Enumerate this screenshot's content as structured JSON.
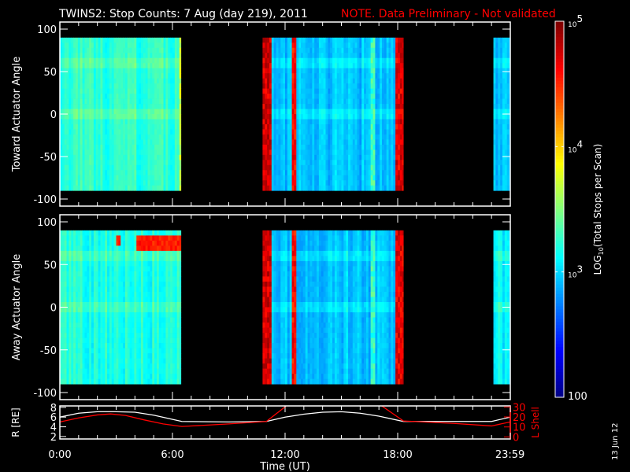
{
  "title": {
    "main": "TWINS2: Stop Counts:  7 Aug (day 219), 2011",
    "note": "NOTE. Data Preliminary - Not validated",
    "note_color": "#ff0000"
  },
  "side_date": "13 Jun 12",
  "chart_data": {
    "type": "heatmap",
    "x_range_hours": [
      0,
      24
    ],
    "xlabel": "Time (UT)",
    "xticks": [
      {
        "h": 0,
        "label": "0:00"
      },
      {
        "h": 6,
        "label": "6:00"
      },
      {
        "h": 12,
        "label": "12:00"
      },
      {
        "h": 18,
        "label": "18:00"
      },
      {
        "h": 23.983,
        "label": "23:59"
      }
    ],
    "colorbar": {
      "label": "LOG10(Total Stops per Scan)",
      "label_main": "LOG",
      "label_sub": "10",
      "label_rest": "(Total Stops per Scan)",
      "range_log": [
        2,
        5
      ],
      "ticks": [
        {
          "log": 5,
          "label": "10",
          "exp": "5"
        },
        {
          "log": 4,
          "label": "10",
          "exp": "4"
        },
        {
          "log": 3,
          "label": "10",
          "exp": "3"
        },
        {
          "log": 2,
          "label": "100",
          "exp": ""
        }
      ]
    },
    "panels": [
      {
        "name": "toward",
        "ylabel": "Toward Actuator Angle",
        "ylim": [
          -100,
          100
        ],
        "data_range": [
          -90,
          90
        ],
        "yticks": [
          100,
          50,
          0,
          -50,
          -100
        ],
        "segments": [
          {
            "start": 0.0,
            "end": 6.45,
            "base_log": 3.25
          },
          {
            "start": 10.8,
            "end": 18.3,
            "base_log": 2.95
          },
          {
            "start": 23.1,
            "end": 24.0,
            "base_log": 2.95
          }
        ],
        "stripes": [
          {
            "start": 10.8,
            "end": 11.25,
            "log": 4.75
          },
          {
            "start": 12.3,
            "end": 12.55,
            "log": 4.6
          },
          {
            "start": 17.9,
            "end": 18.3,
            "log": 4.7
          },
          {
            "start": 6.35,
            "end": 6.45,
            "log": 3.7
          },
          {
            "start": 16.6,
            "end": 16.75,
            "log": 3.3
          }
        ],
        "hotspots": []
      },
      {
        "name": "away",
        "ylabel": "Away Actuator Angle",
        "ylim": [
          -100,
          100
        ],
        "data_range": [
          -90,
          90
        ],
        "yticks": [
          100,
          50,
          0,
          -50,
          -100
        ],
        "segments": [
          {
            "start": 0.0,
            "end": 6.45,
            "base_log": 3.2
          },
          {
            "start": 10.8,
            "end": 18.3,
            "base_log": 2.95
          },
          {
            "start": 23.1,
            "end": 24.0,
            "base_log": 3.1
          }
        ],
        "stripes": [
          {
            "start": 10.8,
            "end": 11.25,
            "log": 4.75
          },
          {
            "start": 12.3,
            "end": 12.55,
            "log": 4.6
          },
          {
            "start": 17.9,
            "end": 18.3,
            "log": 4.7
          },
          {
            "start": 16.6,
            "end": 16.75,
            "log": 3.3
          }
        ],
        "hotspots": [
          {
            "start": 3.0,
            "end": 3.2,
            "angle_min": 70,
            "angle_max": 86,
            "log": 4.5
          },
          {
            "start": 4.0,
            "end": 6.45,
            "angle_min": 65,
            "angle_max": 82,
            "log": 4.55
          }
        ]
      }
    ],
    "orbit": {
      "left_label": "R [RE]",
      "left_label_main": "R [R",
      "left_label_sub": "E",
      "left_label_end": "]",
      "right_label": "L Shell",
      "left_ylim": [
        1.5,
        8.3
      ],
      "left_ticks": [
        2,
        4,
        6,
        8
      ],
      "right_ylim": [
        -2,
        31
      ],
      "right_ticks": [
        0,
        10,
        20,
        30
      ],
      "r_color": "#ffffff",
      "l_color": "#ff0000",
      "r_series": {
        "h": [
          0,
          1,
          2,
          3,
          4,
          5,
          6.5,
          9,
          11,
          12,
          13,
          14,
          15,
          16,
          17,
          18.3,
          21,
          23,
          24
        ],
        "v": [
          6,
          6.8,
          7.1,
          7.1,
          7,
          6.4,
          5.1,
          5,
          5.1,
          6,
          6.6,
          7,
          7.1,
          6.8,
          6.2,
          5.1,
          5.1,
          5.1,
          6
        ]
      },
      "l_series": [
        {
          "h": [
            0,
            1,
            2,
            2.7,
            3.5,
            4.5,
            5.5,
            6.5,
            9,
            11,
            12.2
          ],
          "v": [
            15,
            19,
            22,
            23,
            21.5,
            17,
            13,
            10.5,
            13,
            15.5,
            33
          ]
        },
        {
          "h": [
            17,
            18.3,
            21,
            23,
            24
          ],
          "v": [
            33,
            16,
            13.5,
            11,
            15
          ]
        }
      ]
    }
  }
}
